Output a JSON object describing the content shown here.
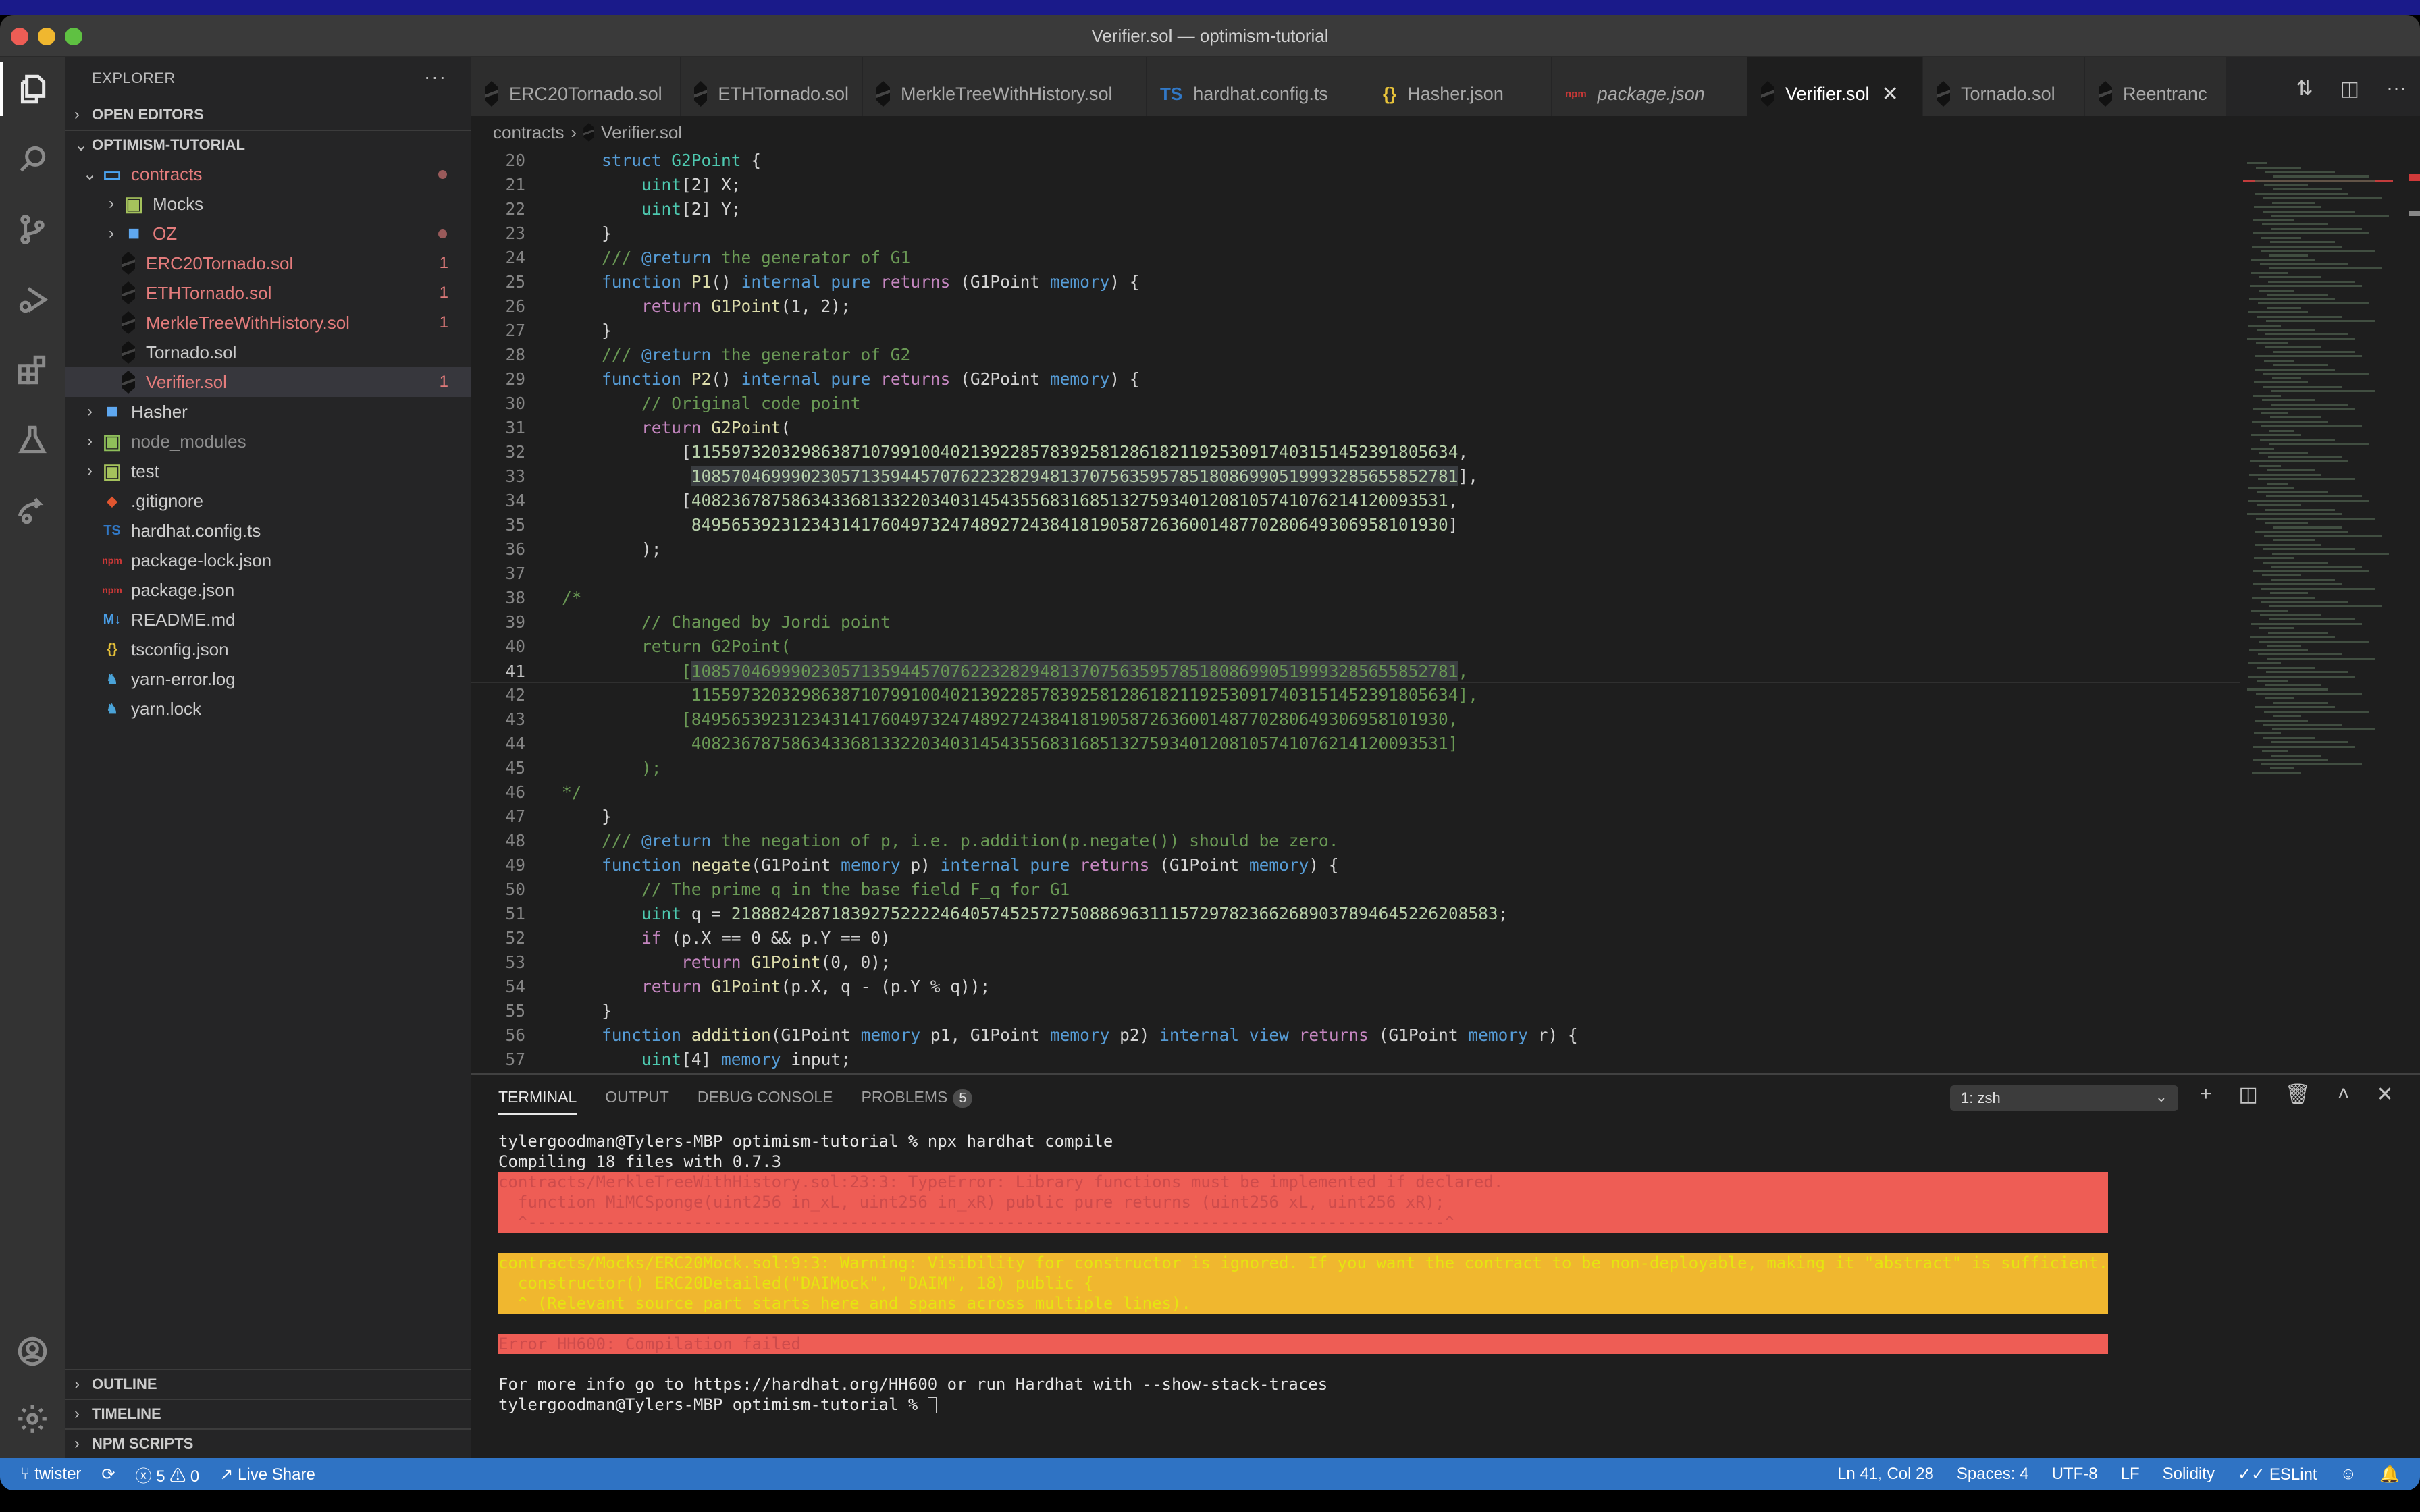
{
  "window": {
    "title": "Verifier.sol — optimism-tutorial"
  },
  "activity_bar": [
    {
      "name": "explorer-icon",
      "active": true
    },
    {
      "name": "search-icon"
    },
    {
      "name": "source-control-icon"
    },
    {
      "name": "run-debug-icon"
    },
    {
      "name": "extensions-icon"
    },
    {
      "name": "testing-icon"
    },
    {
      "name": "live-share-icon"
    },
    {
      "name": "accounts-icon"
    },
    {
      "name": "manage-gear-icon"
    }
  ],
  "sidebar": {
    "title": "EXPLORER",
    "more": "···",
    "open_editors": "OPEN EDITORS",
    "project": "OPTIMISM-TUTORIAL",
    "tree": [
      {
        "label": "contracts",
        "type": "folder-open",
        "depth": 0,
        "color": "red",
        "dot": true
      },
      {
        "label": "Mocks",
        "type": "folder-test",
        "depth": 1
      },
      {
        "label": "OZ",
        "type": "folder",
        "depth": 1,
        "color": "red",
        "dot": true
      },
      {
        "label": "ERC20Tornado.sol",
        "type": "sol",
        "depth": 1,
        "color": "red",
        "badge": "1"
      },
      {
        "label": "ETHTornado.sol",
        "type": "sol",
        "depth": 1,
        "color": "red",
        "badge": "1"
      },
      {
        "label": "MerkleTreeWithHistory.sol",
        "type": "sol",
        "depth": 1,
        "color": "red",
        "badge": "1"
      },
      {
        "label": "Tornado.sol",
        "type": "sol",
        "depth": 1
      },
      {
        "label": "Verifier.sol",
        "type": "sol",
        "depth": 1,
        "color": "red",
        "badge": "1",
        "selected": true
      },
      {
        "label": "Hasher",
        "type": "folder",
        "depth": 0
      },
      {
        "label": "node_modules",
        "type": "folder-node",
        "depth": 0,
        "muted": true
      },
      {
        "label": "test",
        "type": "folder-test",
        "depth": 0
      },
      {
        "label": ".gitignore",
        "type": "git",
        "depth": 0
      },
      {
        "label": "hardhat.config.ts",
        "type": "ts",
        "depth": 0
      },
      {
        "label": "package-lock.json",
        "type": "npm",
        "depth": 0
      },
      {
        "label": "package.json",
        "type": "npm",
        "depth": 0
      },
      {
        "label": "README.md",
        "type": "md",
        "depth": 0
      },
      {
        "label": "tsconfig.json",
        "type": "json",
        "depth": 0
      },
      {
        "label": "yarn-error.log",
        "type": "yarn",
        "depth": 0
      },
      {
        "label": "yarn.lock",
        "type": "yarn",
        "depth": 0
      }
    ],
    "bottom_sections": [
      "OUTLINE",
      "TIMELINE",
      "NPM SCRIPTS"
    ]
  },
  "tabs": [
    {
      "label": "ERC20Tornado.sol",
      "icon": "sol"
    },
    {
      "label": "ETHTornado.sol",
      "icon": "sol"
    },
    {
      "label": "MerkleTreeWithHistory.sol",
      "icon": "sol"
    },
    {
      "label": "hardhat.config.ts",
      "icon": "ts"
    },
    {
      "label": "Hasher.json",
      "icon": "json"
    },
    {
      "label": "package.json",
      "icon": "npm",
      "italic": true
    },
    {
      "label": "Verifier.sol",
      "icon": "sol",
      "active": true,
      "close": "✕"
    },
    {
      "label": "Tornado.sol",
      "icon": "sol"
    },
    {
      "label": "Reentranc",
      "icon": "sol"
    }
  ],
  "breadcrumb": [
    "contracts",
    "Verifier.sol"
  ],
  "editor": {
    "current_line": 41,
    "lines": [
      {
        "n": "20",
        "t": [
          [
            "    ",
            "pl"
          ],
          [
            "struct ",
            "kw"
          ],
          [
            "G2Point",
            "ty"
          ],
          [
            " {",
            "pl"
          ]
        ]
      },
      {
        "n": "21",
        "t": [
          [
            "        ",
            "pl"
          ],
          [
            "uint",
            "ty"
          ],
          [
            "[2] X;",
            "pl"
          ]
        ]
      },
      {
        "n": "22",
        "t": [
          [
            "        ",
            "pl"
          ],
          [
            "uint",
            "ty"
          ],
          [
            "[2] Y;",
            "pl"
          ]
        ]
      },
      {
        "n": "23",
        "t": [
          [
            "    }",
            "pl"
          ]
        ]
      },
      {
        "n": "24",
        "t": [
          [
            "    /// ",
            "ct"
          ],
          [
            "@return",
            "kw"
          ],
          [
            " the generator of G1",
            "ct"
          ]
        ]
      },
      {
        "n": "25",
        "t": [
          [
            "    ",
            "pl"
          ],
          [
            "function ",
            "kw"
          ],
          [
            "P1",
            "fn"
          ],
          [
            "() ",
            "pl"
          ],
          [
            "internal pure ",
            "kw"
          ],
          [
            "returns",
            "cl"
          ],
          [
            " (G1Point ",
            "pl"
          ],
          [
            "memory",
            "kw"
          ],
          [
            ") {",
            "pl"
          ]
        ]
      },
      {
        "n": "26",
        "t": [
          [
            "        ",
            "pl"
          ],
          [
            "return ",
            "cl"
          ],
          [
            "G1Point",
            "fn"
          ],
          [
            "(1, 2);",
            "pl"
          ]
        ]
      },
      {
        "n": "27",
        "t": [
          [
            "    }",
            "pl"
          ]
        ]
      },
      {
        "n": "28",
        "t": [
          [
            "    /// ",
            "ct"
          ],
          [
            "@return",
            "kw"
          ],
          [
            " the generator of G2",
            "ct"
          ]
        ]
      },
      {
        "n": "29",
        "t": [
          [
            "    ",
            "pl"
          ],
          [
            "function ",
            "kw"
          ],
          [
            "P2",
            "fn"
          ],
          [
            "() ",
            "pl"
          ],
          [
            "internal pure ",
            "kw"
          ],
          [
            "returns",
            "cl"
          ],
          [
            " (G2Point ",
            "pl"
          ],
          [
            "memory",
            "kw"
          ],
          [
            ") {",
            "pl"
          ]
        ]
      },
      {
        "n": "30",
        "t": [
          [
            "        // Original code point",
            "ct"
          ]
        ]
      },
      {
        "n": "31",
        "t": [
          [
            "        ",
            "pl"
          ],
          [
            "return ",
            "cl"
          ],
          [
            "G2Point",
            "fn"
          ],
          [
            "(",
            "pl"
          ]
        ]
      },
      {
        "n": "32",
        "t": [
          [
            "            [",
            "pl"
          ],
          [
            "11559732032986387107991004021392285783925812861821192530917403151452391805634",
            "nm"
          ],
          [
            ",",
            "pl"
          ]
        ]
      },
      {
        "n": "33",
        "t": [
          [
            "             ",
            "pl"
          ],
          [
            "10857046999023057135944570762232829481370756359578518086990519993285655852781",
            "nm sel"
          ],
          [
            "],",
            "pl"
          ]
        ]
      },
      {
        "n": "34",
        "t": [
          [
            "            [",
            "pl"
          ],
          [
            "4082367875863433681332203403145435568316851327593401208105741076214120093531",
            "nm"
          ],
          [
            ",",
            "pl"
          ]
        ]
      },
      {
        "n": "35",
        "t": [
          [
            "             ",
            "pl"
          ],
          [
            "8495653923123431417604973247489272438418190587263600148770280649306958101930",
            "nm"
          ],
          [
            "]",
            "pl"
          ]
        ]
      },
      {
        "n": "36",
        "t": [
          [
            "        );",
            "pl"
          ]
        ]
      },
      {
        "n": "37",
        "t": []
      },
      {
        "n": "38",
        "t": [
          [
            "/*",
            "ct"
          ]
        ]
      },
      {
        "n": "39",
        "t": [
          [
            "        // Changed by Jordi point",
            "ct"
          ]
        ]
      },
      {
        "n": "40",
        "t": [
          [
            "        return G2Point(",
            "ct"
          ]
        ]
      },
      {
        "n": "41",
        "t": [
          [
            "            [",
            "ct"
          ],
          [
            "10857046999023057135944570762232829481370756359578518086990519993285655852781",
            "ct sel"
          ],
          [
            ",",
            "ct"
          ]
        ]
      },
      {
        "n": "42",
        "t": [
          [
            "             11559732032986387107991004021392285783925812861821192530917403151452391805634],",
            "ct"
          ]
        ]
      },
      {
        "n": "43",
        "t": [
          [
            "            [8495653923123431417604973247489272438418190587263600148770280649306958101930,",
            "ct"
          ]
        ]
      },
      {
        "n": "44",
        "t": [
          [
            "             4082367875863433681332203403145435568316851327593401208105741076214120093531]",
            "ct"
          ]
        ]
      },
      {
        "n": "45",
        "t": [
          [
            "        );",
            "ct"
          ]
        ]
      },
      {
        "n": "46",
        "t": [
          [
            "*/",
            "ct"
          ]
        ]
      },
      {
        "n": "47",
        "t": [
          [
            "    }",
            "pl"
          ]
        ]
      },
      {
        "n": "48",
        "t": [
          [
            "    /// ",
            "ct"
          ],
          [
            "@return",
            "kw"
          ],
          [
            " the negation of p, i.e. p.addition(p.negate()) should be zero.",
            "ct"
          ]
        ]
      },
      {
        "n": "49",
        "t": [
          [
            "    ",
            "pl"
          ],
          [
            "function ",
            "kw"
          ],
          [
            "negate",
            "fn"
          ],
          [
            "(G1Point ",
            "pl"
          ],
          [
            "memory",
            "kw"
          ],
          [
            " p) ",
            "pl"
          ],
          [
            "internal pure ",
            "kw"
          ],
          [
            "returns",
            "cl"
          ],
          [
            " (G1Point ",
            "pl"
          ],
          [
            "memory",
            "kw"
          ],
          [
            ") {",
            "pl"
          ]
        ]
      },
      {
        "n": "50",
        "t": [
          [
            "        // The prime q in the base field F_q for G1",
            "ct"
          ]
        ]
      },
      {
        "n": "51",
        "t": [
          [
            "        ",
            "pl"
          ],
          [
            "uint",
            "ty"
          ],
          [
            " q = ",
            "pl"
          ],
          [
            "21888242871839275222246405745257275088696311157297823662689037894645226208583",
            "nm"
          ],
          [
            ";",
            "pl"
          ]
        ]
      },
      {
        "n": "52",
        "t": [
          [
            "        ",
            "pl"
          ],
          [
            "if",
            "cl"
          ],
          [
            " (p.X == 0 && p.Y == 0)",
            "pl"
          ]
        ]
      },
      {
        "n": "53",
        "t": [
          [
            "            ",
            "pl"
          ],
          [
            "return ",
            "cl"
          ],
          [
            "G1Point",
            "fn"
          ],
          [
            "(0, 0);",
            "pl"
          ]
        ]
      },
      {
        "n": "54",
        "t": [
          [
            "        ",
            "pl"
          ],
          [
            "return ",
            "cl"
          ],
          [
            "G1Point",
            "fn"
          ],
          [
            "(p.X, q - (p.Y % q));",
            "pl"
          ]
        ]
      },
      {
        "n": "55",
        "t": [
          [
            "    }",
            "pl"
          ]
        ]
      },
      {
        "n": "56",
        "t": [
          [
            "    ",
            "pl"
          ],
          [
            "function ",
            "kw"
          ],
          [
            "addition",
            "fn"
          ],
          [
            "(G1Point ",
            "pl"
          ],
          [
            "memory",
            "kw"
          ],
          [
            " p1, G1Point ",
            "pl"
          ],
          [
            "memory",
            "kw"
          ],
          [
            " p2) ",
            "pl"
          ],
          [
            "internal view ",
            "kw"
          ],
          [
            "returns",
            "cl"
          ],
          [
            " (G1Point ",
            "pl"
          ],
          [
            "memory",
            "kw"
          ],
          [
            " r) {",
            "pl"
          ]
        ]
      },
      {
        "n": "57",
        "t": [
          [
            "        ",
            "pl"
          ],
          [
            "uint",
            "ty"
          ],
          [
            "[4] ",
            "pl"
          ],
          [
            "memory",
            "kw"
          ],
          [
            " input;",
            "pl"
          ]
        ]
      }
    ]
  },
  "panel": {
    "tabs": [
      {
        "label": "TERMINAL",
        "active": true
      },
      {
        "label": "OUTPUT"
      },
      {
        "label": "DEBUG CONSOLE"
      },
      {
        "label": "PROBLEMS",
        "badge": "5"
      }
    ],
    "terminal_select": "1: zsh",
    "terminal_lines": [
      {
        "text": "tylergoodman@Tylers-MBP optimism-tutorial % npx hardhat compile",
        "c": ""
      },
      {
        "text": "Compiling 18 files with 0.7.3",
        "c": ""
      },
      {
        "text": "contracts/MerkleTreeWithHistory.sol:23:3: TypeError: Library functions must be implemented if declared.",
        "c": "t-red"
      },
      {
        "text": "  function MiMCSponge(uint256 in_xL, uint256 in_xR) public pure returns (uint256 xL, uint256 xR);",
        "c": "t-red"
      },
      {
        "text": "  ^----------------------------------------------------------------------------------------------^",
        "c": "t-red"
      },
      {
        "text": "",
        "c": ""
      },
      {
        "text": "contracts/Mocks/ERC20Mock.sol:9:3: Warning: Visibility for constructor is ignored. If you want the contract to be non-deployable, making it \"abstract\" is sufficient.",
        "c": "t-yel"
      },
      {
        "text": "  constructor() ERC20Detailed(\"DAIMock\", \"DAIM\", 18) public {",
        "c": "t-yel"
      },
      {
        "text": "  ^ (Relevant source part starts here and spans across multiple lines).",
        "c": "t-yel"
      },
      {
        "text": "",
        "c": ""
      },
      {
        "text": "Error HH600: Compilation failed",
        "c": "t-red"
      },
      {
        "text": "",
        "c": ""
      },
      {
        "text": "For more info go to https://hardhat.org/HH600 or run Hardhat with --show-stack-traces",
        "c": ""
      },
      {
        "text": "tylergoodman@Tylers-MBP optimism-tutorial % ",
        "c": "",
        "cursor": true
      }
    ]
  },
  "statusbar": {
    "branch": "twister",
    "sync": "⟳",
    "errors": "5",
    "warnings": "0",
    "live_share": "Live Share",
    "position": "Ln 41, Col 28",
    "spaces": "Spaces: 4",
    "encoding": "UTF-8",
    "eol": "LF",
    "language": "Solidity",
    "eslint": "ESLint",
    "colors": {
      "background": "#2f73c4"
    }
  }
}
